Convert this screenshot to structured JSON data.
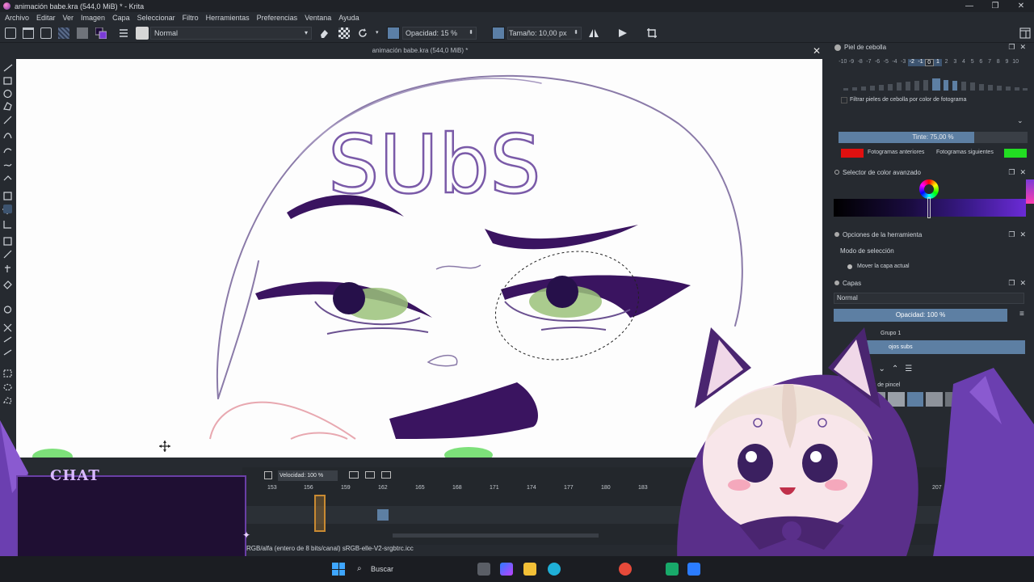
{
  "window": {
    "title": "animación babe.kra (544,0 MiB) * - Krita",
    "minimize": "—",
    "maximize": "❐",
    "close": "✕"
  },
  "menu": [
    "Archivo",
    "Editar",
    "Ver",
    "Imagen",
    "Capa",
    "Seleccionar",
    "Filtro",
    "Herramientas",
    "Preferencias",
    "Ventana",
    "Ayuda"
  ],
  "toolbar": {
    "blend_mode": "Normal",
    "opacity": "Opacidad: 15 %",
    "size": "Tamaño: 10,00 px"
  },
  "document": {
    "tab_title": "animación babe.kra (544,0 MiB) *",
    "close": "✕"
  },
  "onion_skin": {
    "title": "Piel de cebolla",
    "frames": [
      "-10",
      "-9",
      "-8",
      "-7",
      "-6",
      "-5",
      "-4",
      "-3",
      "-2",
      "-1",
      "0",
      "1",
      "2",
      "3",
      "4",
      "5",
      "6",
      "7",
      "8",
      "9",
      "10"
    ],
    "filter_label": "Filtrar pieles de cebolla por color de fotograma",
    "tint": "Tinte: 75,00 %",
    "previous_label": "Fotogramas anteriores",
    "next_label": "Fotogramas siguientes",
    "previous_color": "#e01010",
    "next_color": "#22dd22"
  },
  "color_selector": {
    "title": "Selector de color avanzado"
  },
  "tool_options": {
    "title": "Opciones de la herramienta",
    "mode_label": "Modo de selección",
    "option": "Mover la capa actual"
  },
  "layers": {
    "title": "Capas",
    "blend_mode": "Normal",
    "opacity": "Opacidad:  100 %",
    "rows": [
      {
        "name": "Grupo 1"
      },
      {
        "name": "ojos subs"
      }
    ]
  },
  "brush_presets": {
    "title": "tes de pincel"
  },
  "timeline": {
    "speed": "Velocidad: 100 %",
    "ruler": [
      "153",
      "156",
      "159",
      "162",
      "165",
      "168",
      "171",
      "174",
      "177",
      "180",
      "183",
      "204",
      "207"
    ]
  },
  "status": {
    "color_profile": "RGB/alfa (entero de 8 bits/canal)  sRGB-elle-V2-srgbtrc.icc"
  },
  "overlay": {
    "chat_label": "CHAT"
  },
  "canvas_art": {
    "text": "SUbS"
  },
  "taskbar": {
    "search_placeholder": "Buscar"
  },
  "colors": {
    "accent": "#5d7fa3",
    "line_art": "#3a1460",
    "eye_green": "#8fc070"
  }
}
